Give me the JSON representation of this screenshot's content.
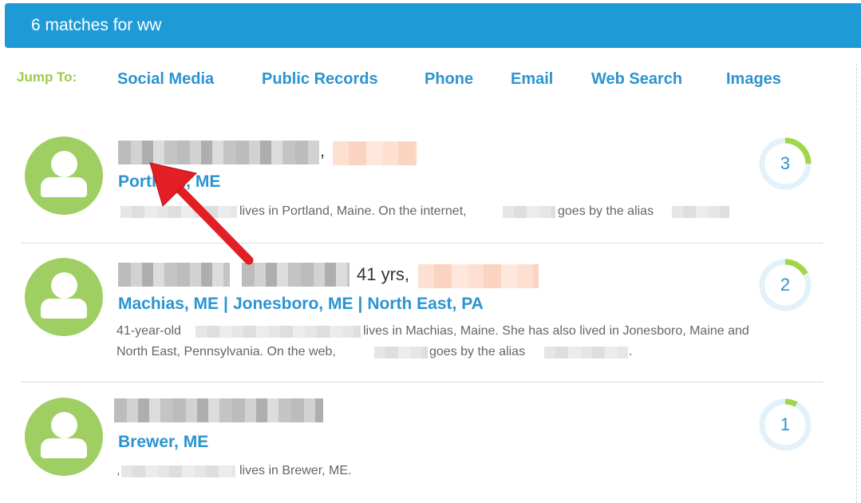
{
  "header": {
    "title": "6 matches for ww"
  },
  "jump": {
    "label": "Jump To:",
    "links": [
      "Social Media",
      "Public Records",
      "Phone",
      "Email",
      "Web Search",
      "Images"
    ]
  },
  "results": [
    {
      "name_suffix": ",",
      "locations": [
        "Portland, ME"
      ],
      "desc_parts": [
        "lives in Portland, Maine. On the internet,",
        "goes by the alias"
      ],
      "score": "3",
      "score_fraction": 0.25
    },
    {
      "name_suffix": "41 yrs,",
      "locations": [
        "Machias, ME",
        "Jonesboro, ME",
        "North East, PA"
      ],
      "separator": "|",
      "desc_line1_start": "41-year-old",
      "desc_line1_end": "lives in Machias, Maine. She has also lived in Jonesboro, Maine and",
      "desc_line2_start": "North East, Pennsylvania. On the web,",
      "desc_line2_mid": "goes by the alias",
      "desc_line2_end": ".",
      "score": "2",
      "score_fraction": 0.17
    },
    {
      "locations": [
        "Brewer, ME"
      ],
      "desc_prefix": ",",
      "desc_text": "lives in Brewer, ME.",
      "score": "1",
      "score_fraction": 0.08
    }
  ],
  "colors": {
    "header_bg": "#1e9ad6",
    "link": "#2b94d0",
    "jump_label": "#9ccc4a",
    "avatar": "#9fce63",
    "score_ring": "#e3f1fa",
    "score_fill": "#9fd64a",
    "arrow": "#e31e24"
  }
}
